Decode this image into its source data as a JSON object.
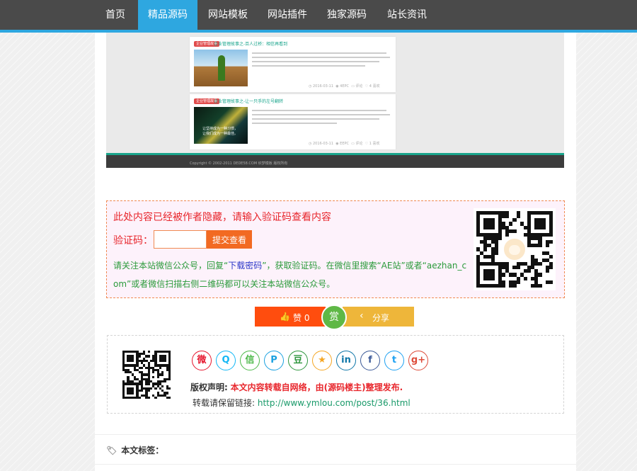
{
  "nav": {
    "items": [
      {
        "label": "首页",
        "active": false
      },
      {
        "label": "精品源码",
        "active": true
      },
      {
        "label": "网站模板",
        "active": false
      },
      {
        "label": "网站插件",
        "active": false
      },
      {
        "label": "独家源码",
        "active": false
      },
      {
        "label": "站长资讯",
        "active": false
      }
    ],
    "accent_color": "#2ea7e0"
  },
  "screenshot_preview": {
    "posts": [
      {
        "tag": "企业管理故事",
        "title": "企业管理故事之-百人过桥：相信再看到",
        "date": "2016-03-11",
        "views": "4EPC",
        "comments": "评论",
        "likes": "4 喜欢"
      },
      {
        "tag": "企业管理故事",
        "title": "企业管理故事之-让一只手的左号翻转",
        "image_text_1": "让坚持成为一种习惯，",
        "image_text_2": "让我们成为一种最佳。",
        "date": "2016-03-11",
        "views": "EEPC",
        "comments": "评论",
        "likes": "1 喜欢"
      }
    ],
    "footer": "Copyright © 2002-2011 DEDE58.COM 织梦模板 版权所有"
  },
  "hidden_content": {
    "title": "此处内容已经被作者隐藏，请输入验证码查看内容",
    "code_label": "验证码：",
    "input_value": "",
    "submit_label": "提交查看",
    "desc_1": "请关注本站微信公众号，回复“",
    "desc_keyword": "下载密码",
    "desc_2": "”，获取验证码。在微信里搜索“AE站”或者“aezhan_com”或者微信扫描右侧二维码都可以关注本站微信公众号。"
  },
  "actions": {
    "like_icon": "thumbs-up-icon",
    "like_label": "赞 0",
    "reward_label": "赏",
    "share_icon": "share-icon",
    "share_label": "分享",
    "like_color": "#ff4d0e",
    "reward_color": "#5fb846",
    "share_color": "#eeb63a"
  },
  "copyright": {
    "share_icons": [
      {
        "name": "weibo-icon",
        "glyph": "微",
        "color": "#e6162d"
      },
      {
        "name": "qq-icon",
        "glyph": "Q",
        "color": "#12b7f5"
      },
      {
        "name": "wechat-icon",
        "glyph": "信",
        "color": "#4cb848"
      },
      {
        "name": "pinterest-icon",
        "glyph": "P",
        "color": "#1aa1e0"
      },
      {
        "name": "douban-icon",
        "glyph": "豆",
        "color": "#2e963d"
      },
      {
        "name": "qzone-icon",
        "glyph": "★",
        "color": "#f5a623"
      },
      {
        "name": "linkedin-icon",
        "glyph": "in",
        "color": "#0e76a8"
      },
      {
        "name": "facebook-icon",
        "glyph": "f",
        "color": "#3b5998"
      },
      {
        "name": "twitter-icon",
        "glyph": "t",
        "color": "#1da1f2"
      },
      {
        "name": "googleplus-icon",
        "glyph": "g+",
        "color": "#dd4b39"
      }
    ],
    "statement_label": "版权声明:",
    "statement_value": "本文内容转载自网络，由(源码楼主)整理发布.",
    "permalink_label": "转载请保留链接:",
    "permalink_url": "http://www.ymlou.com/post/36.html"
  },
  "tags": {
    "label": "本文标签："
  }
}
